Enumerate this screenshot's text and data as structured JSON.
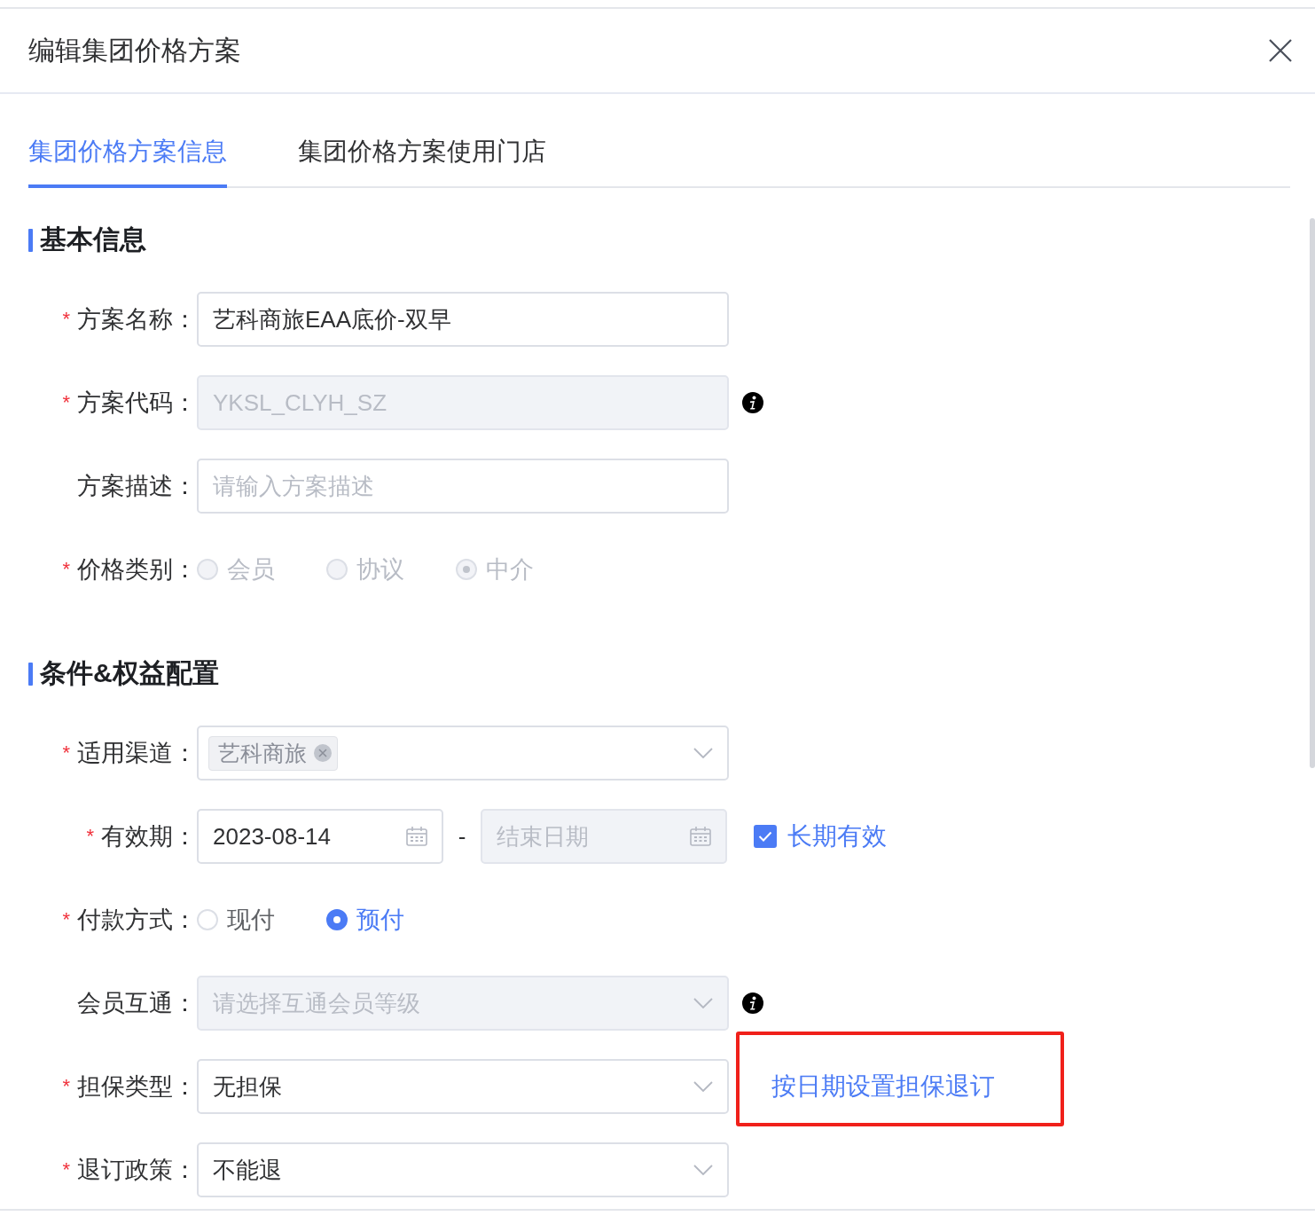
{
  "dialog": {
    "title": "编辑集团价格方案"
  },
  "tabs": [
    {
      "label": "集团价格方案信息",
      "selected": true
    },
    {
      "label": "集团价格方案使用门店",
      "selected": false
    }
  ],
  "sections": [
    {
      "title": "基本信息",
      "fields": [
        {
          "label": "方案名称：",
          "asterisk": "*",
          "kind": "input",
          "value": "艺科商旅EAA底价-双早",
          "disabled": false
        },
        {
          "label": "方案代码：",
          "asterisk": "*",
          "kind": "input",
          "value": "YKSL_CLYH_SZ",
          "disabled": true,
          "info": true
        },
        {
          "label": "方案描述：",
          "kind": "input",
          "placeholder": "请输入方案描述",
          "disabled": false
        },
        {
          "label": "价格类别：",
          "asterisk": "*",
          "kind": "radio",
          "disabled": true,
          "options": [
            {
              "label": "会员",
              "selected": false
            },
            {
              "label": "协议",
              "selected": false
            },
            {
              "label": "中介",
              "selected": true
            }
          ]
        }
      ]
    },
    {
      "title": "条件&权益配置",
      "fields": [
        {
          "label": "适用渠道：",
          "asterisk": "*",
          "kind": "tags",
          "tags": [
            "艺科商旅"
          ],
          "disabled": false
        },
        {
          "label": "有效期：",
          "asterisk": "*",
          "kind": "daterange",
          "start": {
            "value": "2023-08-14",
            "disabled": false
          },
          "separator": "-",
          "end": {
            "placeholder": "结束日期",
            "disabled": true
          },
          "checkbox": {
            "label": "长期有效",
            "checked": true
          }
        },
        {
          "label": "付款方式：",
          "asterisk": "*",
          "kind": "radio",
          "disabled": false,
          "options": [
            {
              "label": "现付",
              "selected": false
            },
            {
              "label": "预付",
              "selected": true
            }
          ]
        },
        {
          "label": "会员互通：",
          "kind": "select",
          "placeholder": "请选择互通会员等级",
          "disabled": true,
          "info": true
        },
        {
          "label": "担保类型：",
          "asterisk": "*",
          "kind": "select",
          "value": "无担保",
          "disabled": false,
          "link": {
            "label": "按日期设置担保退订",
            "highlighted": true
          }
        },
        {
          "label": "退订政策：",
          "asterisk": "*",
          "kind": "select",
          "value": "不能退",
          "disabled": false
        }
      ]
    }
  ]
}
